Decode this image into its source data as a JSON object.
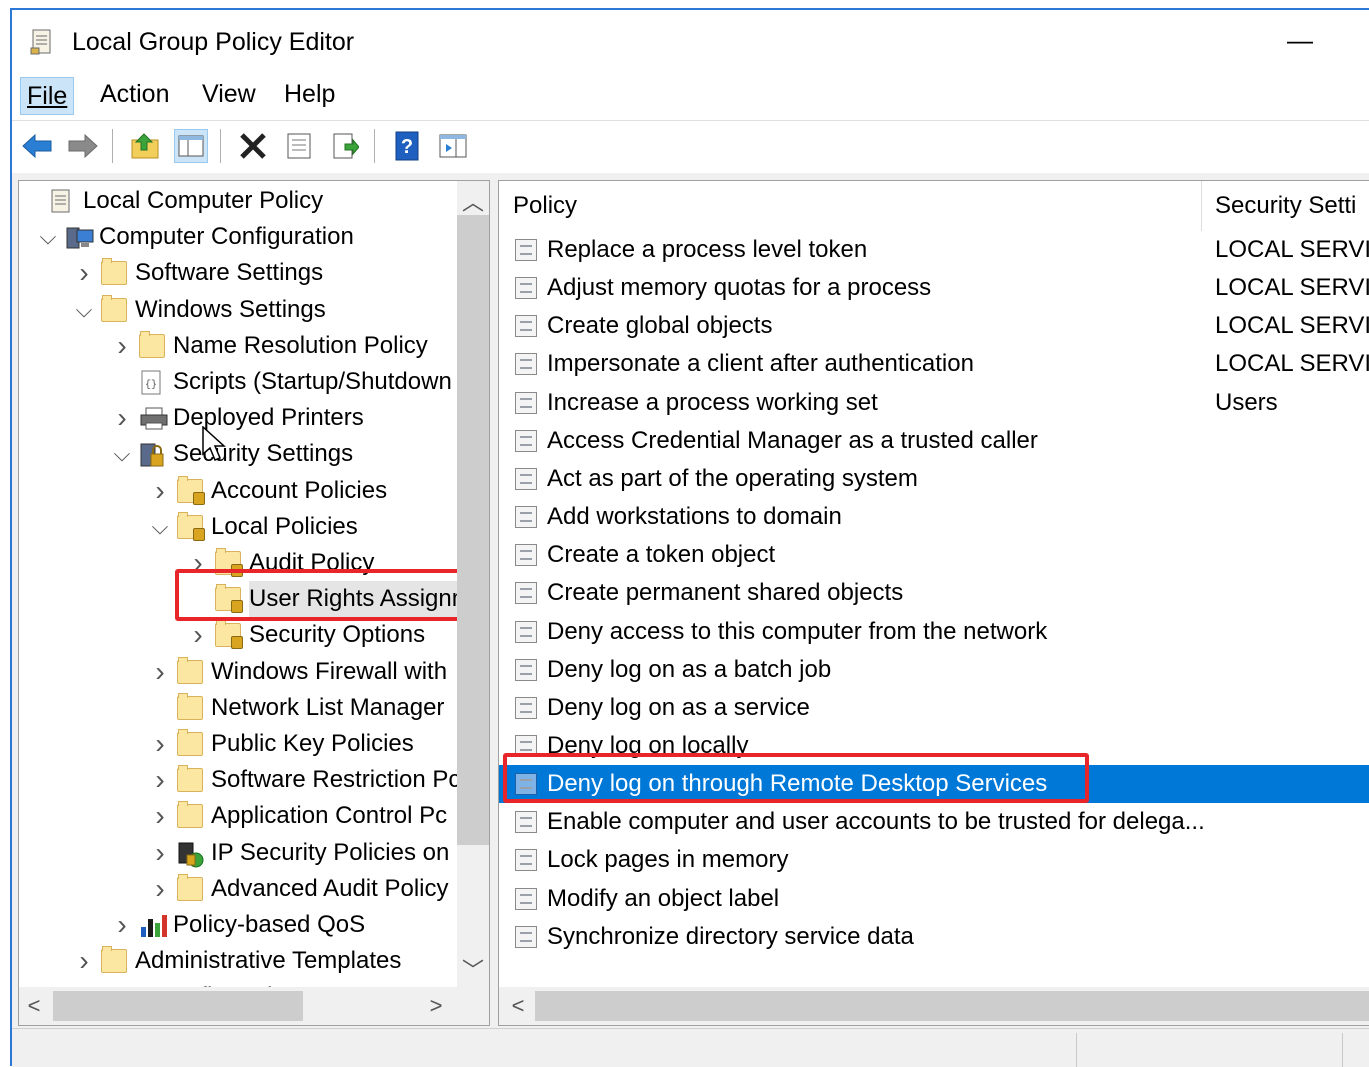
{
  "window": {
    "title": "Local Group Policy Editor",
    "minimize_glyph": "—",
    "accent_color": "#2b78d6"
  },
  "menu": {
    "file": "File",
    "action": "Action",
    "view": "View",
    "help": "Help"
  },
  "toolbar": {
    "icons": [
      "back-arrow-icon",
      "forward-arrow-icon",
      "up-folder-icon",
      "show-hide-tree-icon",
      "delete-icon",
      "properties-icon",
      "export-list-icon",
      "help-icon",
      "show-action-pane-icon"
    ]
  },
  "tree": {
    "items": [
      {
        "label": "Local Computer Policy"
      },
      {
        "label": "Computer Configuration"
      },
      {
        "label": "Software Settings"
      },
      {
        "label": "Windows Settings"
      },
      {
        "label": "Name Resolution Policy"
      },
      {
        "label": "Scripts (Startup/Shutdown"
      },
      {
        "label": "Deployed Printers"
      },
      {
        "label": "Security Settings"
      },
      {
        "label": "Account Policies"
      },
      {
        "label": "Local Policies"
      },
      {
        "label": "Audit Policy"
      },
      {
        "label": "User Rights Assignm"
      },
      {
        "label": "Security Options"
      },
      {
        "label": "Windows Firewall with"
      },
      {
        "label": "Network List Manager"
      },
      {
        "label": "Public Key Policies"
      },
      {
        "label": "Software Restriction Pc"
      },
      {
        "label": "Application Control Pc"
      },
      {
        "label": "IP Security Policies on"
      },
      {
        "label": "Advanced Audit Policy"
      },
      {
        "label": "Policy-based QoS"
      },
      {
        "label": "Administrative Templates"
      },
      {
        "label": "User Configuration"
      }
    ]
  },
  "list": {
    "columns": {
      "policy": "Policy",
      "setting": "Security Setti"
    },
    "rows": [
      {
        "policy": "Replace a process level token",
        "setting": "LOCAL SERVI"
      },
      {
        "policy": "Adjust memory quotas for a process",
        "setting": "LOCAL SERVI"
      },
      {
        "policy": "Create global objects",
        "setting": "LOCAL SERVI"
      },
      {
        "policy": "Impersonate a client after authentication",
        "setting": "LOCAL SERVI"
      },
      {
        "policy": "Increase a process working set",
        "setting": "Users"
      },
      {
        "policy": "Access Credential Manager as a trusted caller",
        "setting": ""
      },
      {
        "policy": "Act as part of the operating system",
        "setting": ""
      },
      {
        "policy": "Add workstations to domain",
        "setting": ""
      },
      {
        "policy": "Create a token object",
        "setting": ""
      },
      {
        "policy": "Create permanent shared objects",
        "setting": ""
      },
      {
        "policy": "Deny access to this computer from the network",
        "setting": ""
      },
      {
        "policy": "Deny log on as a batch job",
        "setting": ""
      },
      {
        "policy": "Deny log on as a service",
        "setting": ""
      },
      {
        "policy": "Deny log on locally",
        "setting": ""
      },
      {
        "policy": "Deny log on through Remote Desktop Services",
        "setting": "",
        "selected": true
      },
      {
        "policy": "Enable computer and user accounts to be trusted for delega...",
        "setting": ""
      },
      {
        "policy": "Lock pages in memory",
        "setting": ""
      },
      {
        "policy": "Modify an object label",
        "setting": ""
      },
      {
        "policy": "Synchronize directory service data",
        "setting": ""
      }
    ]
  },
  "highlight_color": "#e8262a",
  "selection_color": "#0078d7"
}
